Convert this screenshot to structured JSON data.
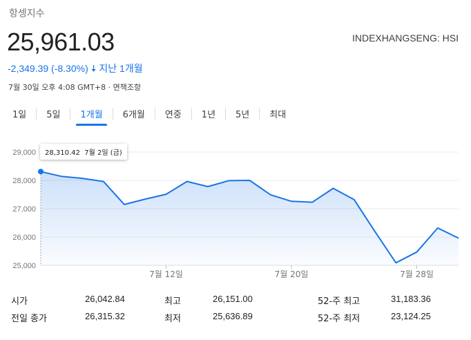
{
  "header": {
    "title": "항셍지수",
    "price": "25,961.03",
    "exchange": "INDEXHANGSENG: HSI",
    "change": "-2,349.39 (-8.30%)",
    "change_period": "지난 1개월",
    "timestamp": "7월 30일 오후 4:08 GMT+8 · 면책조항",
    "accent_color": "#1a73e8"
  },
  "tabs": [
    {
      "label": "1일",
      "active": false
    },
    {
      "label": "5일",
      "active": false
    },
    {
      "label": "1개월",
      "active": true
    },
    {
      "label": "6개월",
      "active": false
    },
    {
      "label": "연중",
      "active": false
    },
    {
      "label": "1년",
      "active": false
    },
    {
      "label": "5년",
      "active": false
    },
    {
      "label": "최대",
      "active": false
    }
  ],
  "tooltip": {
    "value": "28,310.42",
    "date": "7월 2일 (금)"
  },
  "chart_data": {
    "type": "area",
    "ylim": [
      25000,
      29000
    ],
    "yticks": [
      29000,
      28000,
      27000,
      26000,
      25000
    ],
    "ytick_labels": [
      "29,000",
      "28,000",
      "27,000",
      "26,000",
      "25,000"
    ],
    "xtick_labels": [
      {
        "label": "7월 12일",
        "index": 6
      },
      {
        "label": "7월 20일",
        "index": 12
      },
      {
        "label": "7월 28일",
        "index": 18
      }
    ],
    "x": [
      "7/2",
      "7/5",
      "7/6",
      "7/7",
      "7/8",
      "7/9",
      "7/12",
      "7/13",
      "7/14",
      "7/15",
      "7/16",
      "7/19",
      "7/20",
      "7/21",
      "7/22",
      "7/23",
      "7/26",
      "7/27",
      "7/28",
      "7/29",
      "7/30"
    ],
    "values": [
      28310,
      28140,
      28070,
      27960,
      27150,
      27340,
      27510,
      27960,
      27780,
      27990,
      28000,
      27490,
      27260,
      27230,
      27720,
      27320,
      26190,
      25090,
      25470,
      26320,
      25961
    ],
    "grid": true,
    "line_color": "#1a73e8"
  },
  "stats": {
    "rows": [
      [
        {
          "label": "시가",
          "value": "26,042.84"
        },
        {
          "label": "최고",
          "value": "26,151.00"
        },
        {
          "label": "52-주 최고",
          "value": "31,183.36"
        }
      ],
      [
        {
          "label": "전일 종가",
          "value": "26,315.32"
        },
        {
          "label": "최저",
          "value": "25,636.89"
        },
        {
          "label": "52-주 최저",
          "value": "23,124.25"
        }
      ]
    ]
  }
}
